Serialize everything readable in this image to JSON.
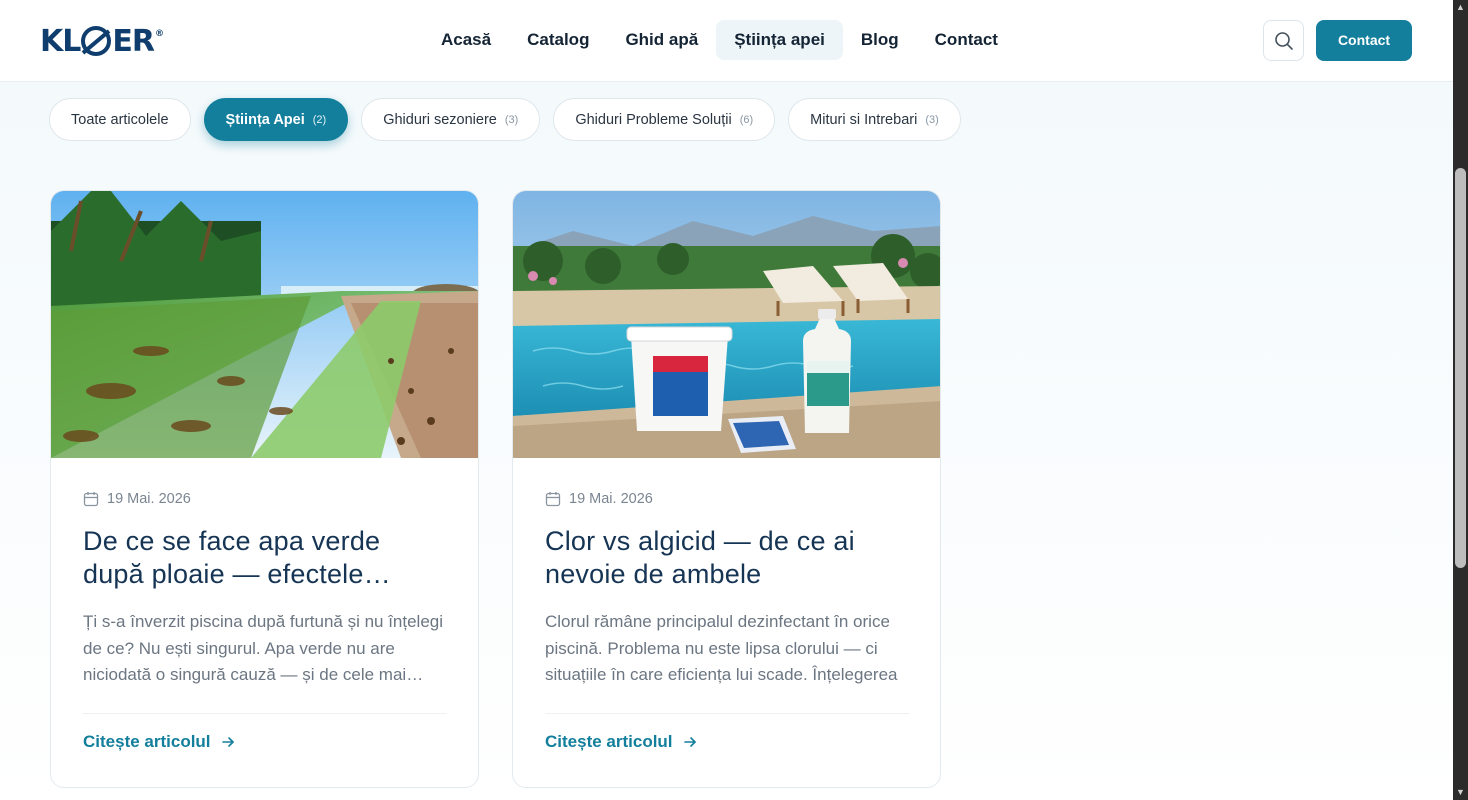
{
  "header": {
    "logo_text": "KLOER",
    "logo_mark": "®",
    "nav": [
      {
        "label": "Acasă",
        "active": false
      },
      {
        "label": "Catalog",
        "active": false
      },
      {
        "label": "Ghid apă",
        "active": false
      },
      {
        "label": "Știința apei",
        "active": true
      },
      {
        "label": "Blog",
        "active": false
      },
      {
        "label": "Contact",
        "active": false
      }
    ],
    "search_icon": "search-icon",
    "contact_button": "Contact"
  },
  "filters": [
    {
      "label": "Toate articolele",
      "count": "",
      "active": false
    },
    {
      "label": "Știința Apei",
      "count": "(2)",
      "active": true
    },
    {
      "label": "Ghiduri sezoniere",
      "count": "(3)",
      "active": false
    },
    {
      "label": "Ghiduri Probleme Soluții",
      "count": "(6)",
      "active": false
    },
    {
      "label": "Mituri si Intrebari",
      "count": "(3)",
      "active": false
    }
  ],
  "articles": [
    {
      "date": "19 Mai. 2026",
      "title": "De ce se face apa verde după ploaie — efectele ascunse ale furtunii",
      "excerpt": "Ți s-a înverzit piscina după furtună și nu înțelegi de ce? Nu ești singurul. Apa verde nu are niciodată o singură cauză — și de cele mai multe ori",
      "read_more": "Citește articolul"
    },
    {
      "date": "19 Mai. 2026",
      "title": "Clor vs algicid — de ce ai nevoie de ambele",
      "excerpt": "Clorul rămâne principalul dezinfectant în orice piscină. Problema nu este lipsa clorului — ci situațiile în care eficiența lui scade. Înțelegerea",
      "read_more": "Citește articolul"
    }
  ],
  "colors": {
    "accent": "#137f9c",
    "title": "#163454",
    "nav_text": "#142434"
  }
}
